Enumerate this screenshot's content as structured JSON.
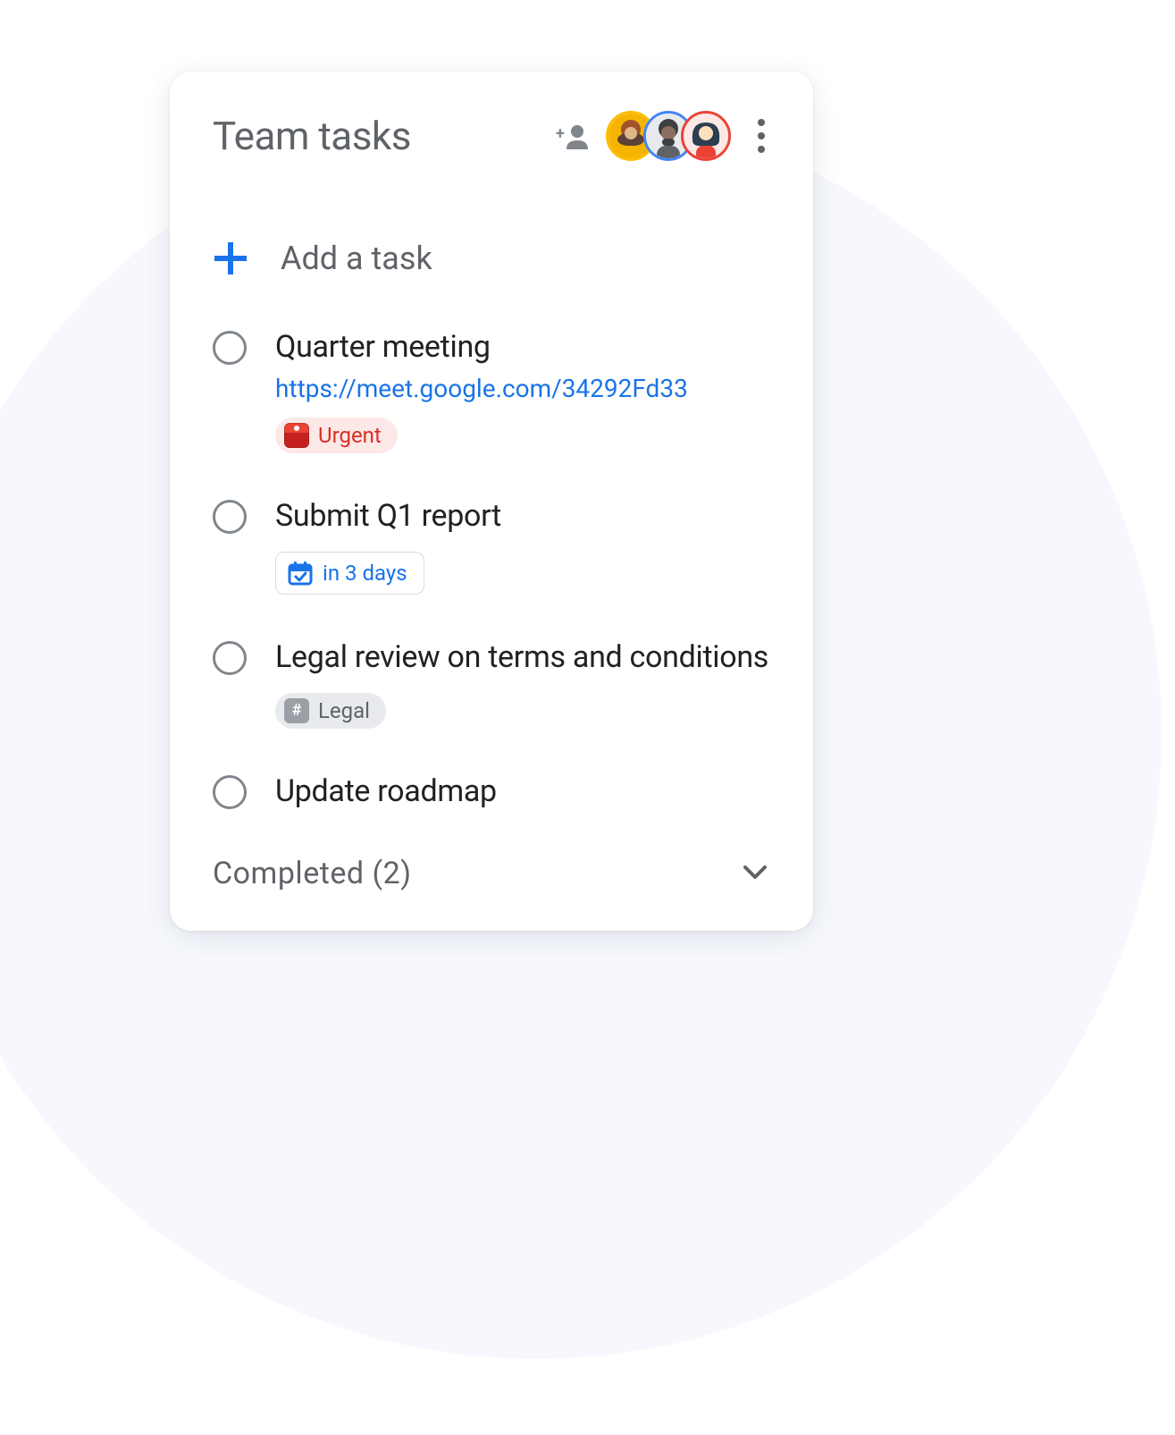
{
  "header": {
    "title": "Team tasks",
    "avatars": [
      {
        "ring": "#fbbc04"
      },
      {
        "ring": "#4285f4"
      },
      {
        "ring": "#ea4335"
      }
    ]
  },
  "add_task_label": "Add a task",
  "tasks": [
    {
      "title": "Quarter meeting",
      "link": "https://meet.google.com/34292Fd33",
      "chip": {
        "type": "urgent",
        "label": "Urgent"
      }
    },
    {
      "title": "Submit Q1 report",
      "chip": {
        "type": "date",
        "label": "in 3 days"
      }
    },
    {
      "title": "Legal review on terms and conditions",
      "chip": {
        "type": "legal",
        "label": "Legal"
      }
    },
    {
      "title": "Update roadmap"
    }
  ],
  "completed": {
    "label": "Completed (2)",
    "count": 2
  }
}
